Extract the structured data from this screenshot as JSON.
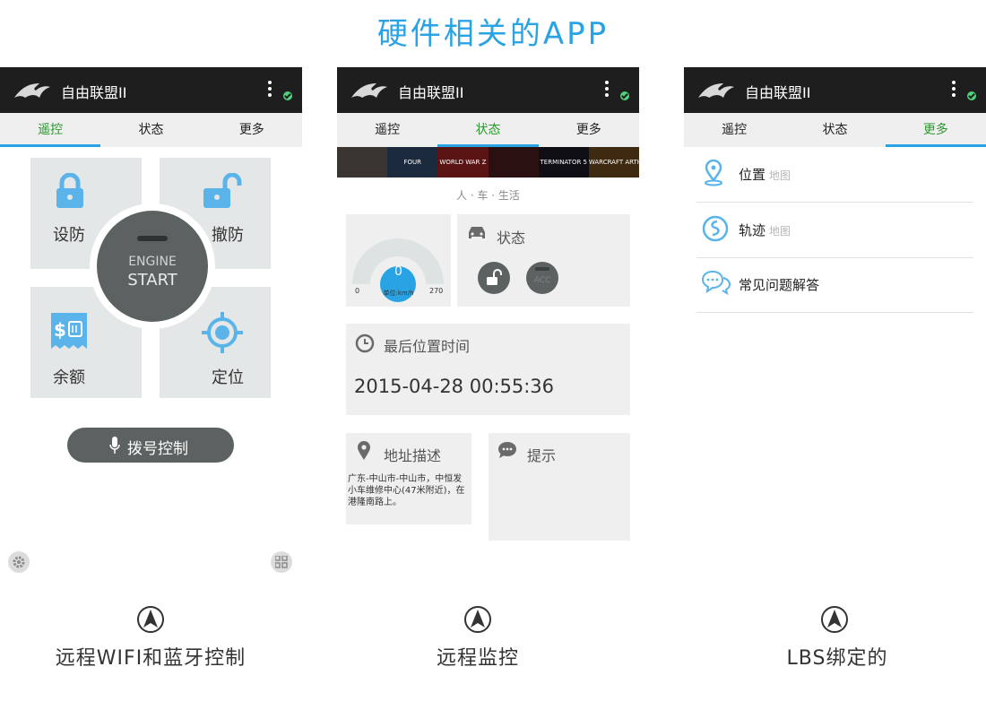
{
  "page_title": "硬件相关的APP",
  "colors": {
    "accent_blue": "#29a3e4",
    "active_tab_green": "#2a9a2e",
    "status_ok_green": "#4ed27a",
    "dark_bar": "#1e1e1e",
    "button_gray": "#5c6262"
  },
  "phones": [
    {
      "app_title": "自由联盟II",
      "tabs": [
        {
          "label": "遥控"
        },
        {
          "label": "状态"
        },
        {
          "label": "更多"
        }
      ],
      "active_tab": 0,
      "tiles": {
        "arm": "设防",
        "disarm": "撤防",
        "balance": "余额",
        "locate": "定位"
      },
      "start_button": {
        "line1": "ENGINE",
        "line2": "START"
      },
      "dial_button": "拨号控制",
      "icons": [
        "lock-icon",
        "unlock-icon",
        "sim-balance-icon",
        "crosshair-icon",
        "mic-icon",
        "gear-icon",
        "grid-icon"
      ]
    },
    {
      "app_title": "自由联盟II",
      "tabs": [
        {
          "label": "遥控"
        },
        {
          "label": "状态"
        },
        {
          "label": "更多"
        }
      ],
      "active_tab": 1,
      "banner": [
        "",
        "FOUR",
        "WORLD WAR Z",
        "",
        "TERMINATOR 5",
        "WARCRAFT ARTHAS"
      ],
      "slogan": "人 · 车 · 生活",
      "speed": {
        "value": "0",
        "min": "0",
        "max": "270",
        "unit": "单位:km/h"
      },
      "status_label": "状态",
      "acc_label": "ACC",
      "last_time_label": "最后位置时间",
      "last_time_value": "2015-04-28 00:55:36",
      "address_label": "地址描述",
      "address_value": "广东-中山市-中山市，中恒发小车维修中心(47米附近)，在港隆南路上。",
      "tip_label": "提示"
    },
    {
      "app_title": "自由联盟II",
      "tabs": [
        {
          "label": "遥控"
        },
        {
          "label": "状态"
        },
        {
          "label": "更多"
        }
      ],
      "active_tab": 2,
      "items": [
        {
          "label": "位置",
          "sub": "地图"
        },
        {
          "label": "轨迹",
          "sub": "地图"
        },
        {
          "label": "常见问题解答",
          "sub": ""
        }
      ]
    }
  ],
  "captions": [
    "远程WIFI和蓝牙控制",
    "远程监控",
    "LBS绑定的"
  ]
}
